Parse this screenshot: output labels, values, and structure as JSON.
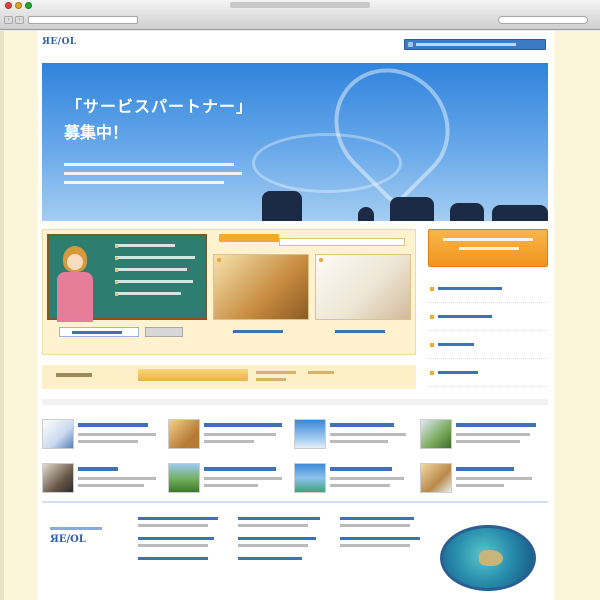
{
  "browser": {
    "back_icon": "back-icon",
    "forward_icon": "forward-icon"
  },
  "site": {
    "logo_text": "ЯЕ/OL",
    "logo_sub": "",
    "hero": {
      "title_line1": "「サービスパートナー」",
      "title_line2": "募集中！"
    }
  },
  "colors": {
    "brand_blue": "#3c7bc4",
    "accent_orange": "#f5a830",
    "hero_sky": "#2f83dc",
    "page_bg": "#fbf5dc"
  }
}
